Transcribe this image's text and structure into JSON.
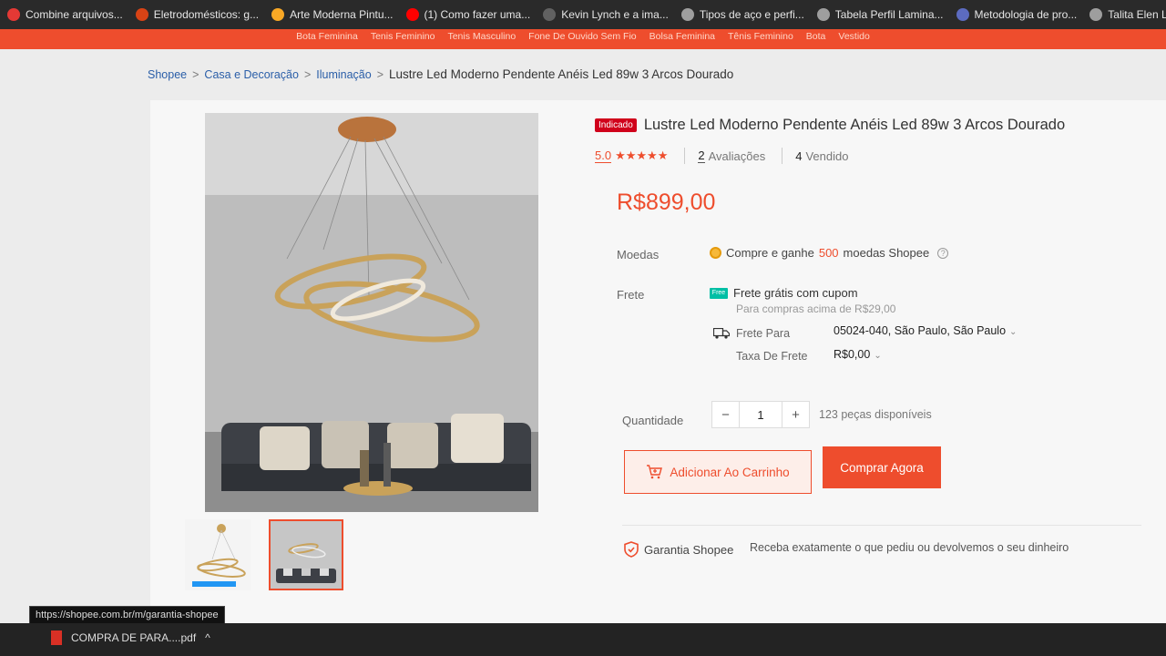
{
  "bookmarks": [
    {
      "label": "Combine arquivos...",
      "icon": "pdf-tool-icon",
      "color": "#e53935"
    },
    {
      "label": "Eletrodomésticos: g...",
      "icon": "store-icon",
      "color": "#d84315"
    },
    {
      "label": "Arte Moderna Pintu...",
      "icon": "globe-icon",
      "color": "#f9a825"
    },
    {
      "label": "(1) Como fazer uma...",
      "icon": "youtube-icon",
      "color": "#ff0000"
    },
    {
      "label": "Kevin Lynch e a ima...",
      "icon": "v-icon",
      "color": "#616161"
    },
    {
      "label": "Tipos de aço e perfi...",
      "icon": "globe-icon",
      "color": "#9e9e9e"
    },
    {
      "label": "Tabela Perfil Lamina...",
      "icon": "globe-icon",
      "color": "#9e9e9e"
    },
    {
      "label": "Metodologia de pro...",
      "icon": "site-icon",
      "color": "#5c6bc0"
    },
    {
      "label": "Talita Elen Lulio De...",
      "icon": "google-icon",
      "color": "#9e9e9e"
    }
  ],
  "shopee_links": [
    "Bota Feminina",
    "Tenis Feminino",
    "Tenis Masculino",
    "Fone De Ouvido Sem Fio",
    "Bolsa Feminina",
    "Tênis Feminino",
    "Bota",
    "Vestido"
  ],
  "breadcrumb": {
    "items": [
      "Shopee",
      "Casa e Decoração",
      "Iluminação"
    ],
    "sep": ">",
    "current": "Lustre Led Moderno Pendente Anéis Led 89w 3 Arcos Dourado"
  },
  "product": {
    "badge": "Indicado",
    "title": "Lustre Led Moderno Pendente Anéis Led 89w 3 Arcos Dourado",
    "rating": "5.0",
    "stars": "★★★★★",
    "reviews_count": "2",
    "reviews_label": "Avaliações",
    "sold_count": "4",
    "sold_label": "Vendido",
    "price": "R$899,00"
  },
  "moedas": {
    "label": "Moedas",
    "text_before": "Compre e ganhe",
    "amount": "500",
    "text_after": "moedas Shopee",
    "help": "?"
  },
  "frete": {
    "label": "Frete",
    "free_badge": "Free",
    "free_text": "Frete grátis com cupom",
    "free_sub": "Para compras acima de R$29,00",
    "para_label": "Frete Para",
    "para_value": "05024-040, São Paulo, São Paulo",
    "taxa_label": "Taxa De Frete",
    "taxa_value": "R$0,00",
    "chevron": "⌄"
  },
  "quantity": {
    "label": "Quantidade",
    "minus": "−",
    "value": "1",
    "plus": "+",
    "available": "123 peças disponíveis"
  },
  "actions": {
    "add_cart": "Adicionar Ao Carrinho",
    "buy_now": "Comprar Agora"
  },
  "garantia": {
    "label": "Garantia Shopee",
    "text": "Receba exatamente o que pediu ou devolvemos o seu dinheiro"
  },
  "status_url": "https://shopee.com.br/m/garantia-shopee",
  "download": {
    "file": "COMPRA DE PARA....pdf",
    "chevron": "^"
  },
  "colors": {
    "brand": "#ee4d2d",
    "badge": "#d0011b",
    "link": "#2a5ea8"
  }
}
